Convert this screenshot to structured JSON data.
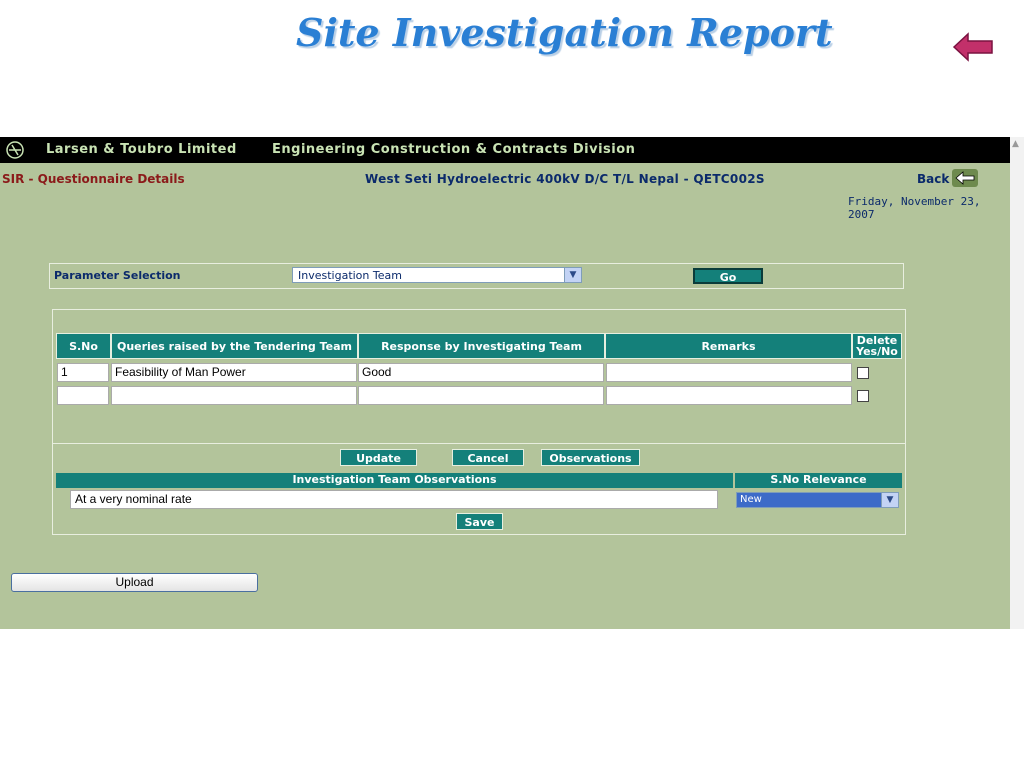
{
  "slide": {
    "title": "Site Investigation Report",
    "back_icon": "back-arrow-icon"
  },
  "header": {
    "company": "Larsen & Toubro Limited",
    "division": "Engineering Construction & Contracts Division"
  },
  "page": {
    "heading": "SIR - Questionnaire Details",
    "project": "West Seti Hydroelectric 400kV D/C T/L Nepal - QETC002S",
    "back_label": "Back",
    "date": "Friday, November 23, 2007"
  },
  "parameter": {
    "label": "Parameter Selection",
    "selected": "Investigation Team",
    "go_label": "Go"
  },
  "table": {
    "columns": [
      "S.No",
      "Queries raised by the Tendering Team",
      "Response by Investigating Team",
      "Remarks",
      "Delete Yes/No"
    ],
    "rows": [
      {
        "sno": "1",
        "query": "Feasibility of Man Power",
        "response": "Good",
        "remarks": "",
        "delete": false
      },
      {
        "sno": "",
        "query": "",
        "response": "",
        "remarks": "",
        "delete": false
      }
    ]
  },
  "actions": {
    "update": "Update",
    "cancel": "Cancel",
    "observations": "Observations"
  },
  "observations": {
    "header": "Investigation Team Observations",
    "value": "At a very nominal rate",
    "relevance_header": "S.No Relevance",
    "relevance_selected": "New",
    "save": "Save"
  },
  "upload": {
    "label": "Upload"
  },
  "colors": {
    "teal": "#14807a",
    "background": "#b3c49b",
    "title": "#2a7fd4",
    "heading": "#8b1a1a"
  }
}
